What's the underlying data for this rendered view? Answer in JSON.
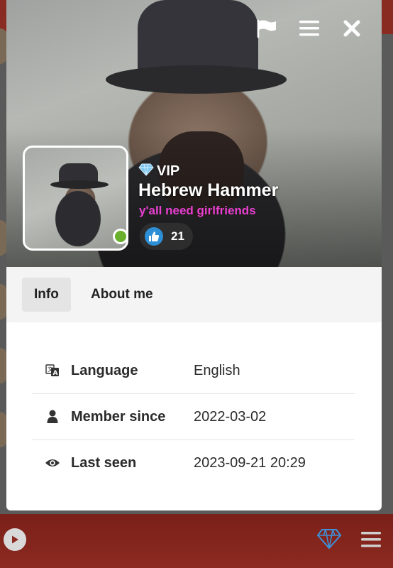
{
  "profile": {
    "vip_label": "VIP",
    "name": "Hebrew Hammer",
    "tagline": "y'all need girlfriends",
    "likes": "21",
    "online": true
  },
  "top_icons": [
    "flag-icon",
    "menu-icon",
    "close-icon"
  ],
  "tabs": [
    {
      "label": "Info",
      "active": true
    },
    {
      "label": "About me",
      "active": false
    }
  ],
  "info_rows": [
    {
      "icon": "language-icon",
      "label": "Language",
      "value": "English"
    },
    {
      "icon": "user-icon",
      "label": "Member since",
      "value": "2022-03-02"
    },
    {
      "icon": "eye-icon",
      "label": "Last seen",
      "value": "2023-09-21 20:29"
    }
  ],
  "bottom_bar": {
    "icons": [
      "play-icon",
      "diamond-icon",
      "menu-icon"
    ]
  },
  "colors": {
    "tagline": "#e83fd0",
    "online": "#6ab02c",
    "like": "#2d8fd6",
    "bottom_bar": "#8c2a20",
    "vip_diamond": "#7ec8f0"
  }
}
